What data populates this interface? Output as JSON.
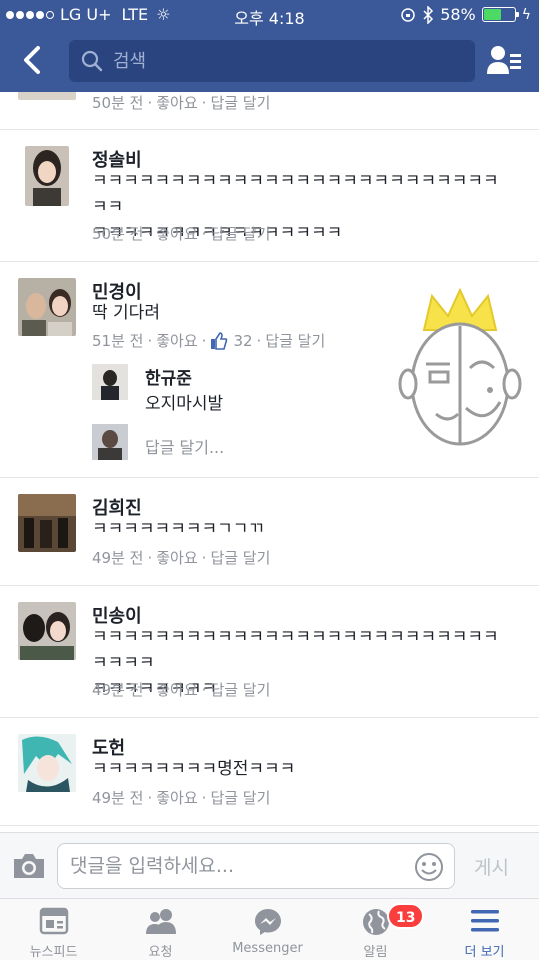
{
  "status_bar": {
    "carrier": "LG U+",
    "network": "LTE",
    "time": "오후 4:18",
    "battery_percent": "58%",
    "battery_level": 0.58
  },
  "header": {
    "search_placeholder": "검색"
  },
  "comments": [
    {
      "meta": {
        "time": "50분 전",
        "like": "좋아요",
        "reply": "답글 달기"
      }
    },
    {
      "name": "정솔비",
      "lines": [
        "ㅋㅋㅋㅋㅋㅋㅋㅋㅋㅋㅋㅋㅋㅋㅋㅋㅋㅋㅋㅋㅋㅋㅋㅋㅋㅋㅋㅋ",
        "ㅋㅋㅋㅋㅋㅋㅋㅋㅋㅋㅋㅋㅋㅋㅋㅋ"
      ],
      "meta": {
        "time": "50분 전",
        "like": "좋아요",
        "reply": "답글 달기"
      }
    },
    {
      "name": "민경이",
      "lines": [
        "딱 기다려"
      ],
      "meta": {
        "time": "51분 전",
        "like": "좋아요",
        "like_count": "32",
        "reply": "답글 달기"
      },
      "reply_item": {
        "name": "한규준",
        "text": "오지마시발"
      },
      "reply_placeholder": "답글 달기..."
    },
    {
      "name": "김희진",
      "lines": [
        "ㅋㅋㅋㅋㅋㅋㅋㅋㄱㄱㄲ"
      ],
      "meta": {
        "time": "49분 전",
        "like": "좋아요",
        "reply": "답글 달기"
      }
    },
    {
      "name": "민송이",
      "lines": [
        "ㅋㅋㅋㅋㅋㅋㅋㅋㅋㅋㅋㅋㅋㅋㅋㅋㅋㅋㅋㅋㅋㅋㅋㅋㅋㅋㅋㅋㅋㅋ",
        "ㅋㅋㅋㅋㅋㅋㅋㅋ"
      ],
      "meta": {
        "time": "49분 전",
        "like": "좋아요",
        "reply": "답글 달기"
      }
    },
    {
      "name": "도헌",
      "lines": [
        "ㅋㅋㅋㅋㅋㅋㅋㅋ명전ㅋㅋㅋ"
      ],
      "meta": {
        "time": "49분 전",
        "like": "좋아요",
        "reply": "답글 달기"
      }
    }
  ],
  "composer": {
    "placeholder": "댓글을 입력하세요...",
    "post_label": "게시"
  },
  "tabs": [
    {
      "label": "뉴스피드",
      "icon": "news-feed-icon"
    },
    {
      "label": "요청",
      "icon": "friend-requests-icon"
    },
    {
      "label": "Messenger",
      "icon": "messenger-icon"
    },
    {
      "label": "알림",
      "icon": "globe-notifications-icon",
      "badge": "13"
    },
    {
      "label": "더 보기",
      "icon": "menu-icon",
      "active": true
    }
  ],
  "colors": {
    "header_bg": "#3b5998",
    "active_tab": "#4267b2",
    "badge": "#fa3e3e",
    "battery": "#4cd964"
  }
}
